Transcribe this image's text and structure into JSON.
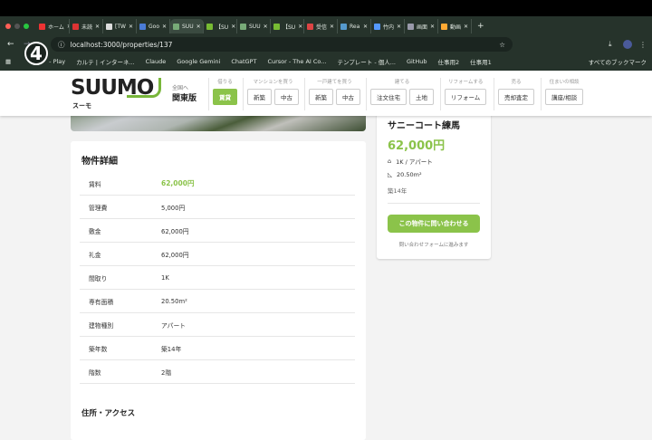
{
  "browser": {
    "tabs": [
      {
        "label": "ホーム",
        "color": "#e33"
      },
      {
        "label": "未読",
        "color": "#d33"
      },
      {
        "label": "[TW",
        "color": "#ddd"
      },
      {
        "label": "Goo",
        "color": "#4a7bd6"
      },
      {
        "label": "SUU",
        "color": "#7a7",
        "active": true
      },
      {
        "label": "【SU",
        "color": "#7b3"
      },
      {
        "label": "SUU",
        "color": "#7a7"
      },
      {
        "label": "【SU",
        "color": "#7b3"
      },
      {
        "label": "受信",
        "color": "#d44"
      },
      {
        "label": "Rea",
        "color": "#59c"
      },
      {
        "label": "竹内",
        "color": "#59f"
      },
      {
        "label": "画面",
        "color": "#99a"
      },
      {
        "label": "動画",
        "color": "#fa3"
      }
    ],
    "url": "localhost:3000/properties/137",
    "bookmarks": [
      "- Play",
      "カルテ | インターネ...",
      "Claude",
      "Google Gemini",
      "ChatGPT",
      "Cursor - The AI Co...",
      "テンプレート - 個人...",
      "GitHub",
      "仕事用2",
      "仕事用1"
    ],
    "all_bookmarks": "すべてのブックマーク",
    "step_badge": "4"
  },
  "header": {
    "logo": "SUUMO",
    "logo_sub": "スーモ",
    "region_small": "全国へ",
    "region": "関東版",
    "nav": [
      {
        "group": "借りる",
        "buttons": [
          "賃貸"
        ]
      },
      {
        "group": "マンションを買う",
        "buttons": [
          "新築",
          "中古"
        ]
      },
      {
        "group": "一戸建てを買う",
        "buttons": [
          "新築",
          "中古"
        ]
      },
      {
        "group": "建てる",
        "buttons": [
          "注文住宅",
          "土地"
        ]
      },
      {
        "group": "リフォームする",
        "buttons": [
          "リフォーム"
        ]
      },
      {
        "group": "売る",
        "buttons": [
          "売却査定"
        ]
      },
      {
        "group": "住まいの相談",
        "buttons": [
          "講座/相談"
        ]
      }
    ]
  },
  "details": {
    "title": "物件詳細",
    "rows": [
      {
        "k": "賃料",
        "v": "62,000円"
      },
      {
        "k": "管理費",
        "v": "5,000円"
      },
      {
        "k": "敷金",
        "v": "62,000円"
      },
      {
        "k": "礼金",
        "v": "62,000円"
      },
      {
        "k": "間取り",
        "v": "1K"
      },
      {
        "k": "専有面積",
        "v": "20.50m²"
      },
      {
        "k": "建物種別",
        "v": "アパート"
      },
      {
        "k": "築年数",
        "v": "築14年"
      },
      {
        "k": "階数",
        "v": "2階"
      }
    ],
    "access_title": "住所・アクセス"
  },
  "summary": {
    "name": "サニーコート練馬",
    "price": "62,000円",
    "layout": "1K / アパート",
    "area": "20.50m²",
    "age": "築14年",
    "cta": "この物件に問い合わせる",
    "note": "問い合わせフォームに進みます"
  },
  "colors": {
    "accent": "#8bc34a"
  }
}
